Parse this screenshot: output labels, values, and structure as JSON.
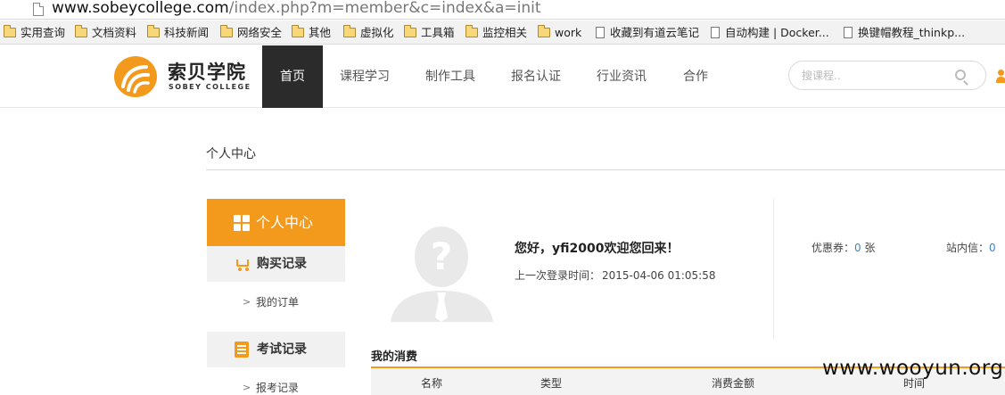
{
  "browser": {
    "url_host": "www.sobeycollege.com",
    "url_path": "/index.php?m=member&c=index&a=init",
    "bookmarks": [
      {
        "label": "实用查询",
        "type": "folder"
      },
      {
        "label": "文档资料",
        "type": "folder"
      },
      {
        "label": "科技新闻",
        "type": "folder"
      },
      {
        "label": "网络安全",
        "type": "folder"
      },
      {
        "label": "其他",
        "type": "folder"
      },
      {
        "label": "虚拟化",
        "type": "folder"
      },
      {
        "label": "工具箱",
        "type": "folder"
      },
      {
        "label": "监控相关",
        "type": "folder"
      },
      {
        "label": "work",
        "type": "folder"
      },
      {
        "label": "收藏到有道云笔记",
        "type": "page"
      },
      {
        "label": "自动构建 | Docker...",
        "type": "page"
      },
      {
        "label": "换键帽教程_thinkp...",
        "type": "page"
      }
    ]
  },
  "header": {
    "logo_cn": "索贝学院",
    "logo_en": "SOBEY COLLEGE",
    "nav": [
      "首页",
      "课程学习",
      "制作工具",
      "报名认证",
      "行业资讯",
      "合作"
    ],
    "active_nav": "首页",
    "search_placeholder": "搜课程.."
  },
  "page": {
    "title": "个人中心"
  },
  "sidebar": {
    "head_label": "个人中心",
    "sections": [
      {
        "label": "购买记录",
        "icon": "cart-icon",
        "links": [
          "我的订单"
        ]
      },
      {
        "label": "考试记录",
        "icon": "exam-icon",
        "links": [
          "报考记录"
        ]
      }
    ]
  },
  "profile": {
    "greeting": "您好，yfi2000欢迎您回来！",
    "last_login_label": "上一次登录时间：",
    "last_login_value": "2015-04-06 01:05:58",
    "coupon_label": "优惠券：",
    "coupon_count": "0",
    "coupon_unit": " 张",
    "message_label": "站内信：",
    "message_count": "0"
  },
  "spending": {
    "title": "我的消费",
    "columns": [
      "名称",
      "类型",
      "消费金额",
      "时间"
    ]
  },
  "watermark": "www.wooyun.org",
  "colors": {
    "accent": "#f39a1c",
    "nav_active_bg": "#2b2b2b",
    "link_number": "#3d84c4"
  }
}
